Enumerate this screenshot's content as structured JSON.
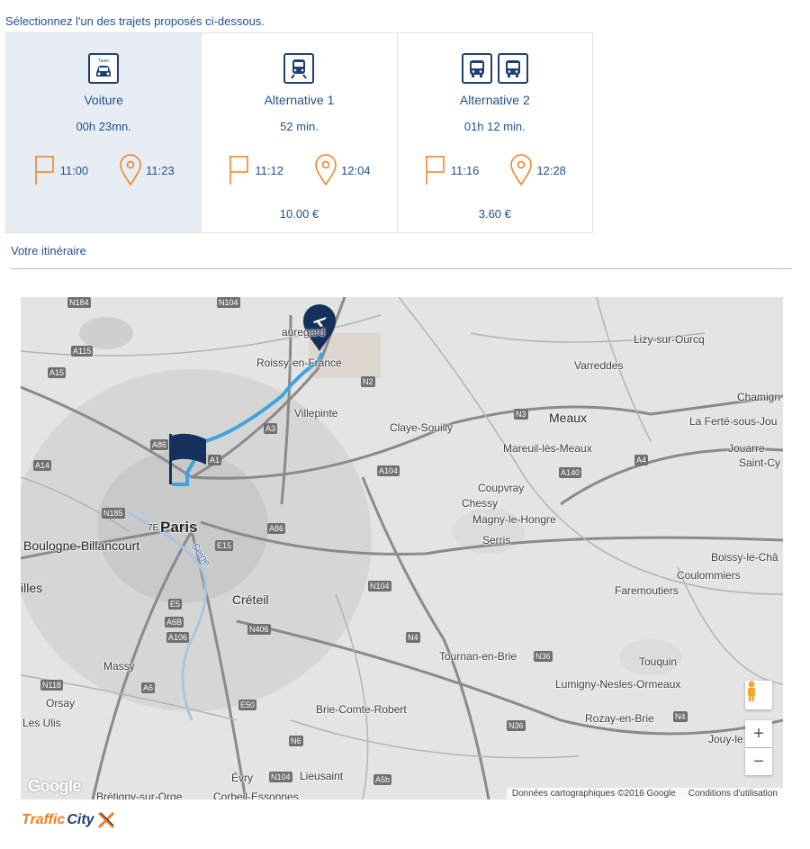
{
  "prompt": "Sélectionnez l'un des trajets proposés ci-dessous.",
  "options": [
    {
      "label": "Voiture",
      "duration": "00h 23mn.",
      "depart": "11:00",
      "arrive": "11:23",
      "price": "",
      "icon_text": "Taxis",
      "icons": [
        "taxi-icon"
      ],
      "selected": true
    },
    {
      "label": "Alternative 1",
      "duration": "52 min.",
      "depart": "11:12",
      "arrive": "12:04",
      "price": "10.00 €",
      "icons": [
        "train-icon"
      ],
      "selected": false
    },
    {
      "label": "Alternative 2",
      "duration": "01h 12 min.",
      "depart": "11:16",
      "arrive": "12:28",
      "price": "3.60 €",
      "icons": [
        "bus-icon",
        "bus-icon"
      ],
      "selected": false
    }
  ],
  "itinerary_label": "Votre itinéraire",
  "map": {
    "places": {
      "paris": "Paris",
      "arr": "7E",
      "boulogne": "Boulogne-Billancourt",
      "creteil": "Créteil",
      "villepinte": "Villepinte",
      "roissy": "Roissy-en-France",
      "beauregard": "auregard",
      "claye": "Claye-Souilly",
      "meaux": "Meaux",
      "mareuil": "Mareuil-lès-Meaux",
      "coupvray": "Coupvray",
      "chessy": "Chessy",
      "magny": "Magny-le-Hongre",
      "serris": "Serris",
      "lizy": "Lizy-sur-Ourcq",
      "varreddes": "Varreddes",
      "chamign": "Chamign",
      "laferte": "La Ferté-sous-Jou",
      "jouarre": "Jouarre",
      "saintcy": "Saint-Cy",
      "boissy": "Boissy-le-Châ",
      "coulommiers": "Coulommiers",
      "faremoutiers": "Faremoutiers",
      "tournan": "Tournan-en-Brie",
      "touquin": "Touquin",
      "lumigny": "Lumigny-Nesles-Ormeaux",
      "rozay": "Rozay-en-Brie",
      "jouy": "Jouy-le",
      "massy": "Massy",
      "orsay": "Orsay",
      "lesulis": "Les Ulis",
      "brie": "Brie-Comte-Robert",
      "evry": "Évry",
      "lieusaint": "Lieusaint",
      "bretigny": "Brétigny-sur-Orge",
      "corbeil": "Corbeil-Essonnes",
      "illes": "illes",
      "seine": "Seine"
    },
    "roads": [
      "N104",
      "N184",
      "A115",
      "A15",
      "A86",
      "A14",
      "N185",
      "A1",
      "A3",
      "N2",
      "N3",
      "A104",
      "A140",
      "A4",
      "E15",
      "E5",
      "A6B",
      "A106",
      "N406",
      "N118",
      "A6",
      "E50",
      "N104",
      "N4",
      "N36",
      "N6",
      "N104",
      "A5b",
      "N36",
      "N4",
      "N36",
      "A86"
    ],
    "attribution": "Données cartographiques ©2016 Google",
    "terms": "Conditions d'utilisation",
    "google": "Google",
    "zoom_in": "+",
    "zoom_out": "−"
  },
  "brand": {
    "part1": "Traffic",
    "part2": "City"
  },
  "colors": {
    "accent": "#1f3f73",
    "orange": "#f07f1e",
    "route": "#3aa6dd",
    "selected_bg": "#e8edf3"
  }
}
